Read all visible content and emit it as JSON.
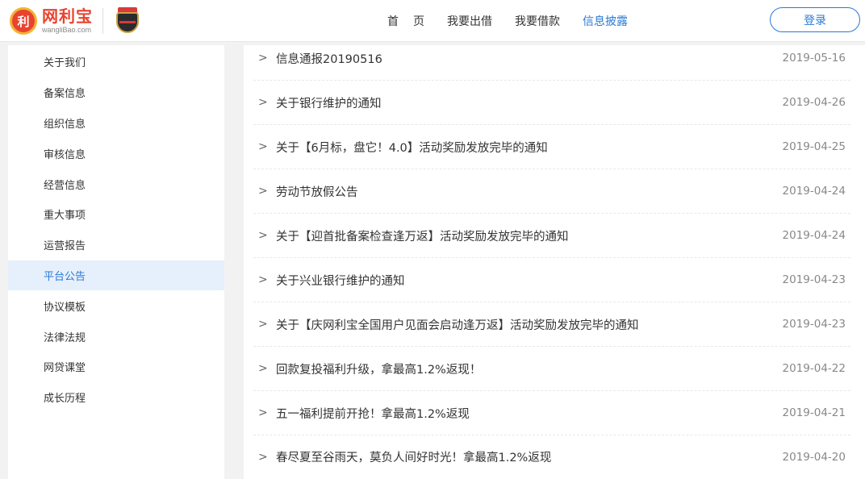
{
  "brand": {
    "logo_glyph": "利",
    "name_cn": "网利宝",
    "name_en": "wangliBao.com"
  },
  "nav": {
    "items": [
      {
        "label": "首页",
        "active": false
      },
      {
        "label": "我要出借",
        "active": false
      },
      {
        "label": "我要借款",
        "active": false
      },
      {
        "label": "信息披露",
        "active": true
      }
    ],
    "login_label": "登录"
  },
  "sidebar": {
    "items": [
      {
        "label": "关于我们"
      },
      {
        "label": "备案信息"
      },
      {
        "label": "组织信息"
      },
      {
        "label": "审核信息"
      },
      {
        "label": "经营信息"
      },
      {
        "label": "重大事项"
      },
      {
        "label": "运营报告"
      },
      {
        "label": "平台公告",
        "active": true
      },
      {
        "label": "协议模板"
      },
      {
        "label": "法律法规"
      },
      {
        "label": "网贷课堂"
      },
      {
        "label": "成长历程"
      }
    ]
  },
  "notices": {
    "arrow": ">",
    "items": [
      {
        "title": "信息通报20190516",
        "date": "2019-05-16"
      },
      {
        "title": "关于银行维护的通知",
        "date": "2019-04-26"
      },
      {
        "title": "关于【6月标，盘它！4.0】活动奖励发放完毕的通知",
        "date": "2019-04-25"
      },
      {
        "title": "劳动节放假公告",
        "date": "2019-04-24"
      },
      {
        "title": "关于【迎首批备案检查逢万返】活动奖励发放完毕的通知",
        "date": "2019-04-24"
      },
      {
        "title": "关于兴业银行维护的通知",
        "date": "2019-04-23"
      },
      {
        "title": "关于【庆网利宝全国用户见面会启动逢万返】活动奖励发放完毕的通知",
        "date": "2019-04-23"
      },
      {
        "title": "回款复投福利升级，拿最高1.2%返现！",
        "date": "2019-04-22"
      },
      {
        "title": "五一福利提前开抢！拿最高1.2%返现",
        "date": "2019-04-21"
      },
      {
        "title": "春尽夏至谷雨天，莫负人间好时光！拿最高1.2%返现",
        "date": "2019-04-20"
      }
    ]
  },
  "colors": {
    "accent": "#2a7ad6",
    "brand_red": "#e8432f",
    "active_bg": "#e6f0fc"
  }
}
